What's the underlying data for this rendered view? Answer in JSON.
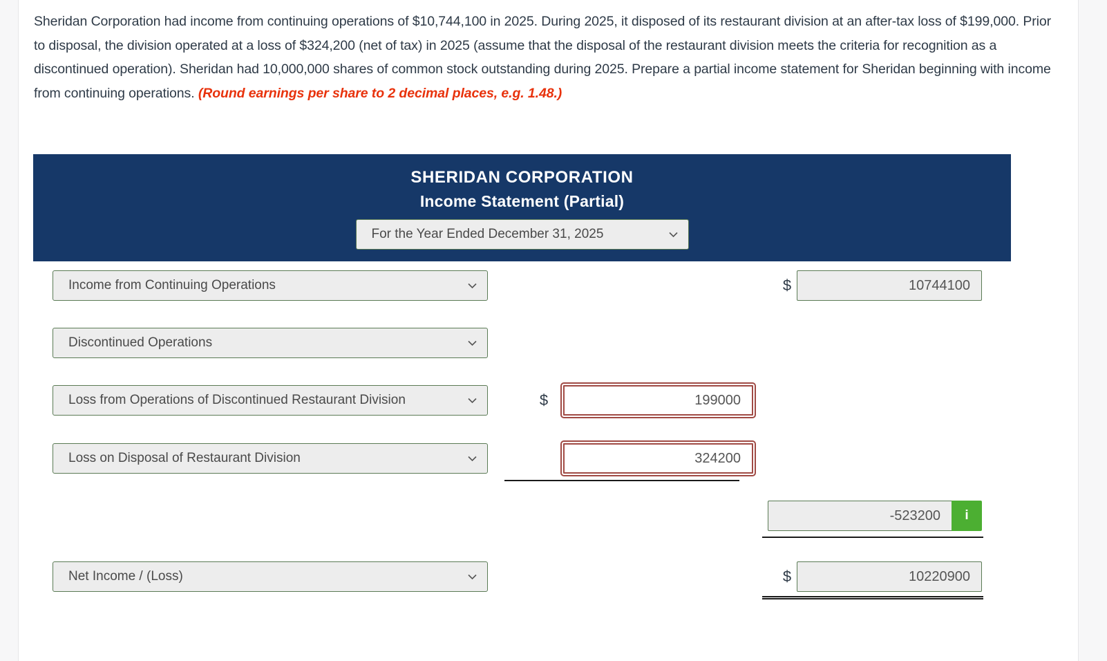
{
  "problem": {
    "text": "Sheridan Corporation had income from continuing operations of $10,744,100 in 2025. During 2025, it disposed of its restaurant division at an after-tax loss of $199,000. Prior to disposal, the division operated at a loss of $324,200 (net of tax) in 2025 (assume that the disposal of the restaurant division meets the criteria for recognition as a discontinued operation). Sheridan had 10,000,000 shares of common stock outstanding during 2025. Prepare a partial income statement for Sheridan beginning with income from continuing operations.",
    "hint": "(Round earnings per share to 2 decimal places, e.g. 1.48.)"
  },
  "statement": {
    "company": "SHERIDAN CORPORATION",
    "title": "Income Statement (Partial)",
    "period": "For the Year Ended December 31, 2025",
    "header_bg": "#163868"
  },
  "rows": [
    {
      "label": "Income from Continuing Operations",
      "col3_dollar": "$",
      "col3_value": "10744100"
    },
    {
      "label": "Discontinued Operations"
    },
    {
      "label": "Loss from Operations of Discontinued Restaurant Division",
      "col2_dollar": "$",
      "col2_value": "199000"
    },
    {
      "label": "Loss on Disposal of Restaurant Division",
      "col2_value": "324200"
    },
    {
      "subtotal_value": "-523200",
      "info_label": "i"
    },
    {
      "label": "Net Income / (Loss)",
      "col3_dollar": "$",
      "col3_value": "10220900"
    }
  ],
  "colors": {
    "accent_navy": "#163868",
    "field_border_green": "#5a7a54",
    "field_fill": "#ededed",
    "error_border": "#a04a44",
    "info_green": "#4caf32",
    "hint_red": "#e8320c"
  },
  "icons": {
    "chevron": "chevron-down-icon",
    "info": "info-icon"
  }
}
